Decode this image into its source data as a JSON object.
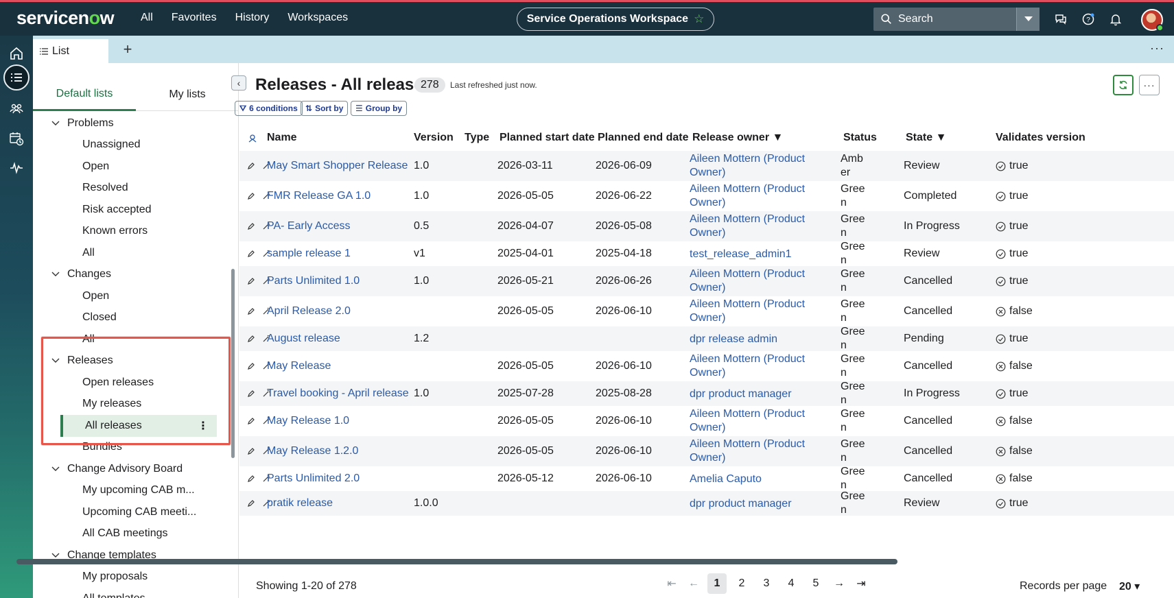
{
  "app": {
    "logo": "servicenow",
    "nav": [
      "All",
      "Favorites",
      "History",
      "Workspaces"
    ],
    "workspace": "Service Operations Workspace",
    "search_placeholder": "Search"
  },
  "tabs": {
    "active": "List"
  },
  "sidebar": {
    "tabs": [
      "Default lists",
      "My lists"
    ],
    "tree": [
      {
        "type": "group",
        "label": "Problems"
      },
      {
        "type": "leaf",
        "label": "Unassigned"
      },
      {
        "type": "leaf",
        "label": "Open"
      },
      {
        "type": "leaf",
        "label": "Resolved"
      },
      {
        "type": "leaf",
        "label": "Risk accepted"
      },
      {
        "type": "leaf",
        "label": "Known errors"
      },
      {
        "type": "leaf",
        "label": "All"
      },
      {
        "type": "group",
        "label": "Changes"
      },
      {
        "type": "leaf",
        "label": "Open"
      },
      {
        "type": "leaf",
        "label": "Closed"
      },
      {
        "type": "leaf",
        "label": "All"
      },
      {
        "type": "group",
        "label": "Releases"
      },
      {
        "type": "leaf",
        "label": "Open releases"
      },
      {
        "type": "leaf",
        "label": "My releases"
      },
      {
        "type": "leaf",
        "label": "All releases",
        "selected": true
      },
      {
        "type": "leaf",
        "label": "Bundles"
      },
      {
        "type": "group",
        "label": "Change Advisory Board"
      },
      {
        "type": "leaf",
        "label": "My upcoming CAB m..."
      },
      {
        "type": "leaf",
        "label": "Upcoming CAB meeti..."
      },
      {
        "type": "leaf",
        "label": "All CAB meetings"
      },
      {
        "type": "group",
        "label": "Change templates"
      },
      {
        "type": "leaf",
        "label": "My proposals"
      },
      {
        "type": "leaf",
        "label": "All templates"
      }
    ]
  },
  "list": {
    "title": "Releases - All releases",
    "count": "278",
    "refreshed": "Last refreshed just now.",
    "chips": [
      "6 conditions",
      "Sort by",
      "Group by"
    ],
    "columns": [
      "Name",
      "Version",
      "Type",
      "Planned start date",
      "Planned end date",
      "Release owner",
      "Status",
      "State",
      "Validates version"
    ],
    "rows": [
      {
        "name": "May Smart Shopper Release",
        "version": "1.0",
        "type": "",
        "start": "2026-03-11",
        "end": "2026-06-09",
        "owner": "Aileen Mottern (Product Owner)",
        "status": "Amber",
        "state": "Review",
        "valid": "true"
      },
      {
        "name": "FMR Release GA 1.0",
        "version": "1.0",
        "type": "",
        "start": "2026-05-05",
        "end": "2026-06-22",
        "owner": "Aileen Mottern (Product Owner)",
        "status": "Green",
        "state": "Completed",
        "valid": "true"
      },
      {
        "name": "PA- Early Access",
        "version": "0.5",
        "type": "",
        "start": "2026-04-07",
        "end": "2026-05-08",
        "owner": "Aileen Mottern (Product Owner)",
        "status": "Green",
        "state": "In Progress",
        "valid": "true"
      },
      {
        "name": "sample release 1",
        "version": "v1",
        "type": "",
        "start": "2025-04-01",
        "end": "2025-04-18",
        "owner": "test_release_admin1",
        "status": "Green",
        "state": "Review",
        "valid": "true"
      },
      {
        "name": "Parts Unlimited 1.0",
        "version": "1.0",
        "type": "",
        "start": "2026-05-21",
        "end": "2026-06-26",
        "owner": "Aileen Mottern (Product Owner)",
        "status": "Green",
        "state": "Cancelled",
        "valid": "true"
      },
      {
        "name": "April Release 2.0",
        "version": "",
        "type": "",
        "start": "2026-05-05",
        "end": "2026-06-10",
        "owner": "Aileen Mottern (Product Owner)",
        "status": "Green",
        "state": "Cancelled",
        "valid": "false"
      },
      {
        "name": "August release",
        "version": "1.2",
        "type": "",
        "start": "",
        "end": "",
        "owner": "dpr release admin",
        "status": "Green",
        "state": "Pending",
        "valid": "true"
      },
      {
        "name": "May Release",
        "version": "",
        "type": "",
        "start": "2026-05-05",
        "end": "2026-06-10",
        "owner": "Aileen Mottern (Product Owner)",
        "status": "Green",
        "state": "Cancelled",
        "valid": "false"
      },
      {
        "name": "Travel booking - April release",
        "version": "1.0",
        "type": "",
        "start": "2025-07-28",
        "end": "2025-08-28",
        "owner": "dpr product manager",
        "status": "Green",
        "state": "In Progress",
        "valid": "true"
      },
      {
        "name": "May Release 1.0",
        "version": "",
        "type": "",
        "start": "2026-05-05",
        "end": "2026-06-10",
        "owner": "Aileen Mottern (Product Owner)",
        "status": "Green",
        "state": "Cancelled",
        "valid": "false"
      },
      {
        "name": "May Release 1.2.0",
        "version": "",
        "type": "",
        "start": "2026-05-05",
        "end": "2026-06-10",
        "owner": "Aileen Mottern (Product Owner)",
        "status": "Green",
        "state": "Cancelled",
        "valid": "false"
      },
      {
        "name": "Parts Unlimited 2.0",
        "version": "",
        "type": "",
        "start": "2026-05-12",
        "end": "2026-06-10",
        "owner": "Amelia Caputo",
        "status": "Green",
        "state": "Cancelled",
        "valid": "false"
      },
      {
        "name": "pratik release",
        "version": "1.0.0",
        "type": "",
        "start": "",
        "end": "",
        "owner": "dpr product manager",
        "status": "Green",
        "state": "Review",
        "valid": "true"
      }
    ]
  },
  "footer": {
    "showing": "Showing 1-20 of 278",
    "pages": [
      "1",
      "2",
      "3",
      "4",
      "5"
    ],
    "current_page": "1",
    "records_label": "Records per page",
    "records_value": "20"
  }
}
